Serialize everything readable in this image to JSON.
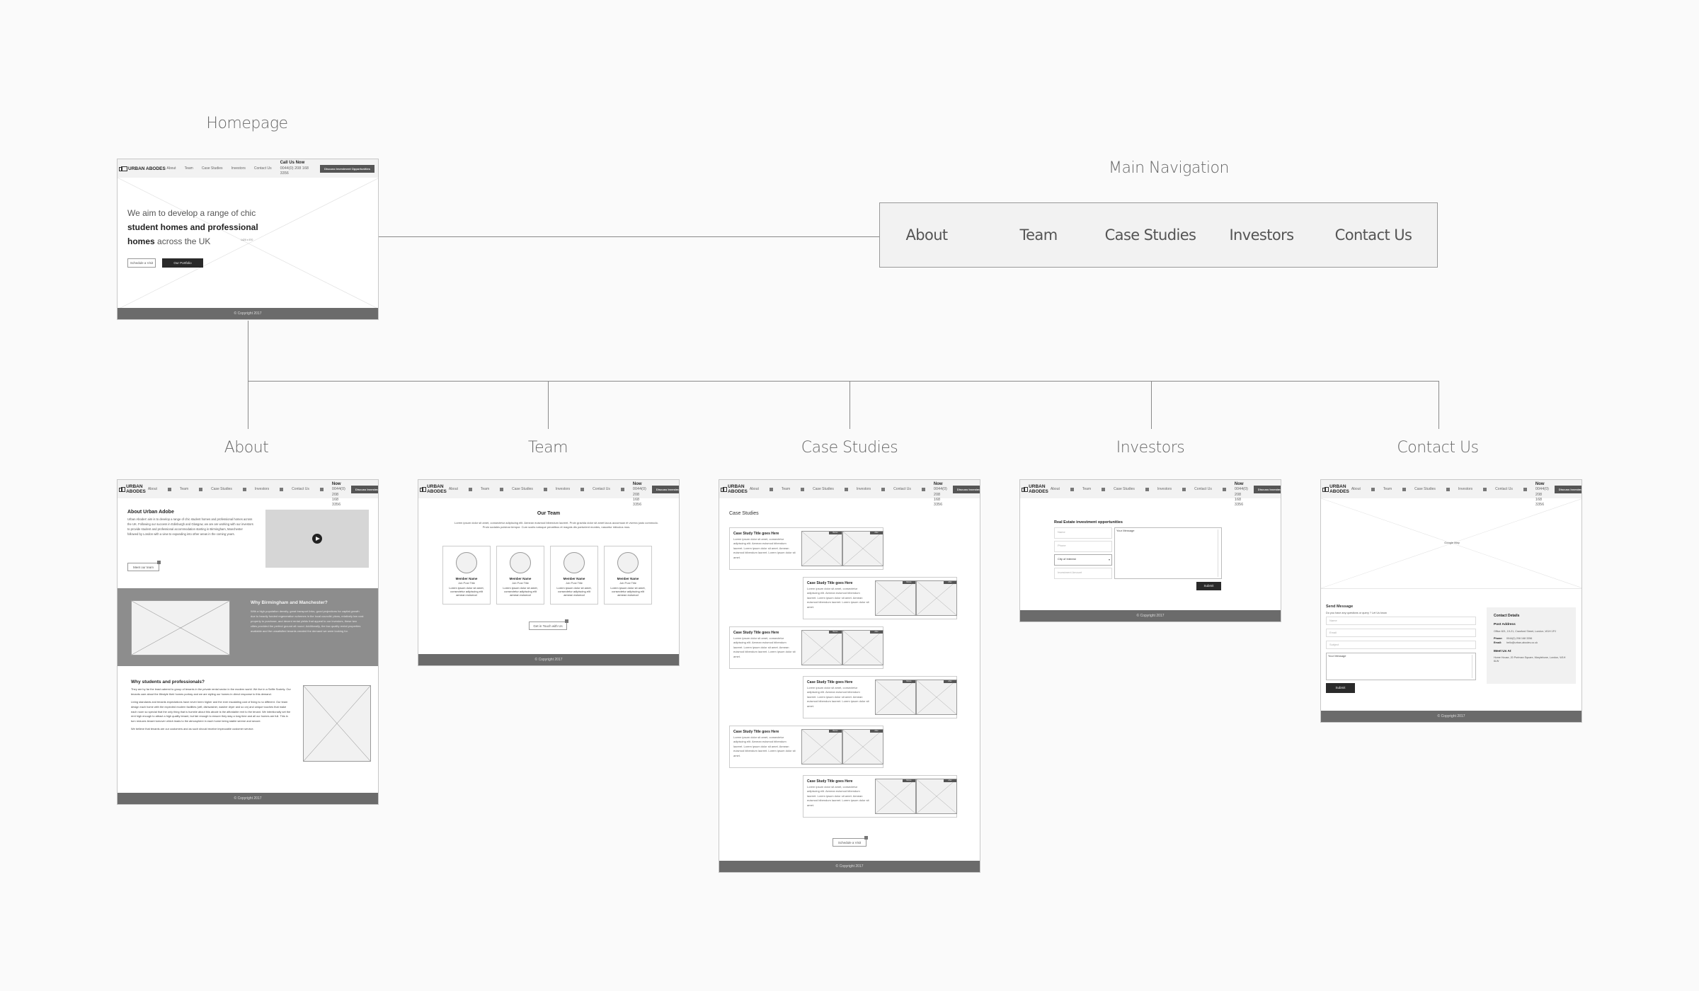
{
  "diagram": {
    "labels": {
      "homepage": "Homepage",
      "main_navigation": "Main Navigation",
      "about": "About",
      "team": "Team",
      "case_studies": "Case Studies",
      "investors": "Investors",
      "contact": "Contact Us"
    },
    "main_navigation_items": [
      "About",
      "Team",
      "Case Studies",
      "Investors",
      "Contact Us"
    ]
  },
  "site_header": {
    "logo": "URBAN ABODES",
    "nav": [
      "About",
      "Team",
      "Case Studies",
      "Investors",
      "Contact Us"
    ],
    "call_label": "Call Us Now",
    "phone": "0044(0) 208 168 3356",
    "cta": "Discuss Investment Opportunities"
  },
  "footer": {
    "copyright": "© Copyright 2017"
  },
  "homepage": {
    "hero_line1": "We aim to develop a range of chic",
    "hero_bold": "student homes and professional",
    "hero_line3_bold": "homes",
    "hero_line3_rest": " across the UK",
    "image_size": "1420 x 570",
    "btn_visit": "Schedule a Visit",
    "btn_portfolio": "Our Portfolio"
  },
  "about": {
    "title": "About Urban Adobe",
    "intro": "Urban Abodes' aim is to develop a range of chic student homes and professional homes across the UK. Following our success in Edinburgh and Glasgow, we are are working with our investors to provide student and professional accommodation starting in Birmingham, Manchester followed by London with a view to expanding into other areas in the coming years.",
    "btn_team": "Meet our team",
    "why_bm_title": "Why Birmingham and Manchester?",
    "why_bm_text": "With a high population density, great transport links, good projections for capital growth due to heavily funded regeneration schemes in the local councils' plans, relatively low cost property to purchase, and decent rental yields that appeal to our investors, these two cities provided the perfect ground all round. Additionally, the low quality rental properties available and the unsatisfied tenants created the demand we were looking for.",
    "why_sp_title": "Why students and professionals?",
    "why_sp_p1": "They are by far the least catered to group of tenants in the private rental sector in the modern world. We live in a Selfie Society. Our tenants care about the lifestyle their homes portray and we are styling our homes in direct response to this demand.",
    "why_sp_p2": "Living standards and tenants expectations have never been higher and the ever escalating cost of living is no different. Our team design each home with the expected modern facilities (wifi, dishwasher, washer dryer and so on) and unique touches that make each room so special that the only thing that is humble about this abode is the affordable rent to the tenant. We intentionally set the rent high enough to attract a high quality tenant, but fair enough to ensure they stay a long time and all our homes are full. This in turn reduces tenant turnover which leads to the atmosphere in each home being stable serene and secure.",
    "why_sp_p3": "We believe that tenants are our customers and as such should receive impeccable customer service."
  },
  "team": {
    "title": "Our Team",
    "intro": "Lorem ipsum dolor sit amet, consectetur adipiscing elit. Aenean euismod bibendum laoreet. Proin gravida dolor sit amet lacus accumsan et viverra justo commodo. Proin sodales pulvinar tempor. Cum sociis natoque penatibus et magnis dis parturient montes, nascetur ridiculus mus.",
    "members": [
      {
        "name": "Member Name",
        "title": "Job Post Title",
        "desc": "Lorem ipsum dolor sit amet, consectetur adipiscing elit aenean euismod"
      },
      {
        "name": "Member Name",
        "title": "Job Post Title",
        "desc": "Lorem ipsum dolor sit amet, consectetur adipiscing elit aenean euismod"
      },
      {
        "name": "Member Name",
        "title": "Job Post Title",
        "desc": "Lorem ipsum dolor sit amet, consectetur adipiscing elit aenean euismod"
      },
      {
        "name": "Member Name",
        "title": "Job Post Title",
        "desc": "Lorem ipsum dolor sit amet, consectetur adipiscing elit aenean euismod"
      }
    ],
    "btn_contact": "Get in Touch with Us"
  },
  "case_studies": {
    "title": "Case Studies",
    "tag_before": "Before",
    "tag_after": "After",
    "items": [
      {
        "title": "Case Study Title goes Here",
        "text": "Lorem ipsum dolor sit amet, consectetur adipiscing elit. Aenean euismod bibendum laoreet. Lorem ipsum dolor sit amet. Aenean euismod bibendum laoreet. Lorem ipsum dolor sit amet."
      },
      {
        "title": "Case Study Title goes Here",
        "text": "Lorem ipsum dolor sit amet, consectetur adipiscing elit. Aenean euismod bibendum laoreet. Lorem ipsum dolor sit amet. Aenean euismod bibendum laoreet. Lorem ipsum dolor sit amet."
      },
      {
        "title": "Case Study Title goes Here",
        "text": "Lorem ipsum dolor sit amet, consectetur adipiscing elit. Aenean euismod bibendum laoreet. Lorem ipsum dolor sit amet. Aenean euismod bibendum laoreet. Lorem ipsum dolor sit amet."
      },
      {
        "title": "Case Study Title goes Here",
        "text": "Lorem ipsum dolor sit amet, consectetur adipiscing elit. Aenean euismod bibendum laoreet. Lorem ipsum dolor sit amet. Aenean euismod bibendum laoreet. Lorem ipsum dolor sit amet."
      },
      {
        "title": "Case Study Title goes Here",
        "text": "Lorem ipsum dolor sit amet, consectetur adipiscing elit. Aenean euismod bibendum laoreet. Lorem ipsum dolor sit amet. Aenean euismod bibendum laoreet. Lorem ipsum dolor sit amet."
      },
      {
        "title": "Case Study Title goes Here",
        "text": "Lorem ipsum dolor sit amet, consectetur adipiscing elit. Aenean euismod bibendum laoreet. Lorem ipsum dolor sit amet. Aenean euismod bibendum laoreet. Lorem ipsum dolor sit amet."
      }
    ],
    "btn_visit": "Schedule a Visit"
  },
  "investors": {
    "title": "Real Estate investment opportunities",
    "ph_name": "Name",
    "ph_phone": "Phone",
    "select_city": "City of Interest",
    "ph_amount": "Investment Amount",
    "ph_message": "Your Message",
    "btn_submit": "Submit"
  },
  "contact": {
    "map_label": "Google Map",
    "send_title": "Send Message",
    "send_sub": "Do you have any questions or query ? Let Us know",
    "ph_name": "Name",
    "ph_email": "Email",
    "ph_subject": "Subject",
    "ph_message": "Your Message",
    "btn_submit": "Submit",
    "details_title": "Contact Details",
    "post_title": "Post Address",
    "post_address": "Office 821, 19-21, Crawford Street, London, W1H 1PJ",
    "phone_label": "Phone:",
    "phone": "0044(0) 208 168 3356",
    "email_label": "Email:",
    "email": "hello@urban-abodes.co.uk",
    "meet_title": "Meet Us At",
    "meet_address": "Home House, 20 Portman Square, Marylebone, London, W1H 6LW"
  }
}
